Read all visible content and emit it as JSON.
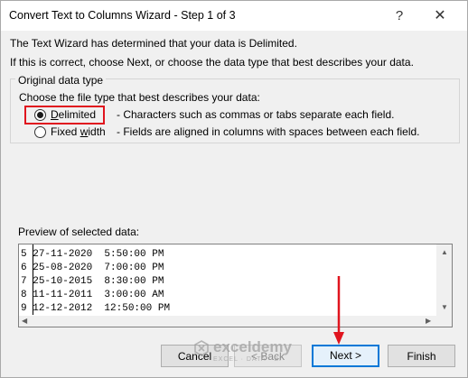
{
  "window": {
    "title": "Convert Text to Columns Wizard - Step 1 of 3",
    "help_label": "?",
    "close_label": "✕"
  },
  "intro": {
    "line1": "The Text Wizard has determined that your data is Delimited.",
    "line2": "If this is correct, choose Next, or choose the data type that best describes your data."
  },
  "original_data_type": {
    "legend": "Original data type",
    "prompt": "Choose the file type that best describes your data:",
    "options": [
      {
        "label_pre": "",
        "label_u": "D",
        "label_post": "elimited",
        "description": "- Characters such as commas or tabs separate each field.",
        "selected": true
      },
      {
        "label_pre": "Fixed ",
        "label_u": "w",
        "label_post": "idth",
        "description": "- Fields are aligned in columns with spaces between each field.",
        "selected": false
      }
    ]
  },
  "preview": {
    "label": "Preview of selected data:",
    "rows": [
      {
        "num": "5",
        "text": "27-11-2020  5:50:00 PM"
      },
      {
        "num": "6",
        "text": "25-08-2020  7:00:00 PM"
      },
      {
        "num": "7",
        "text": "25-10-2015  8:30:00 PM"
      },
      {
        "num": "8",
        "text": "11-11-2011  3:00:00 AM"
      },
      {
        "num": "9",
        "text": "12-12-2012  12:50:00 PM"
      }
    ]
  },
  "buttons": {
    "cancel": "Cancel",
    "back": "< Back",
    "next": "Next >",
    "finish": "Finish"
  },
  "watermark": {
    "name": "exceldemy",
    "tagline": "EXCEL · DATA · BI"
  },
  "colors": {
    "highlight_box": "#e0141e",
    "annotation_arrow": "#e0141e",
    "default_button_border": "#0078d7"
  }
}
